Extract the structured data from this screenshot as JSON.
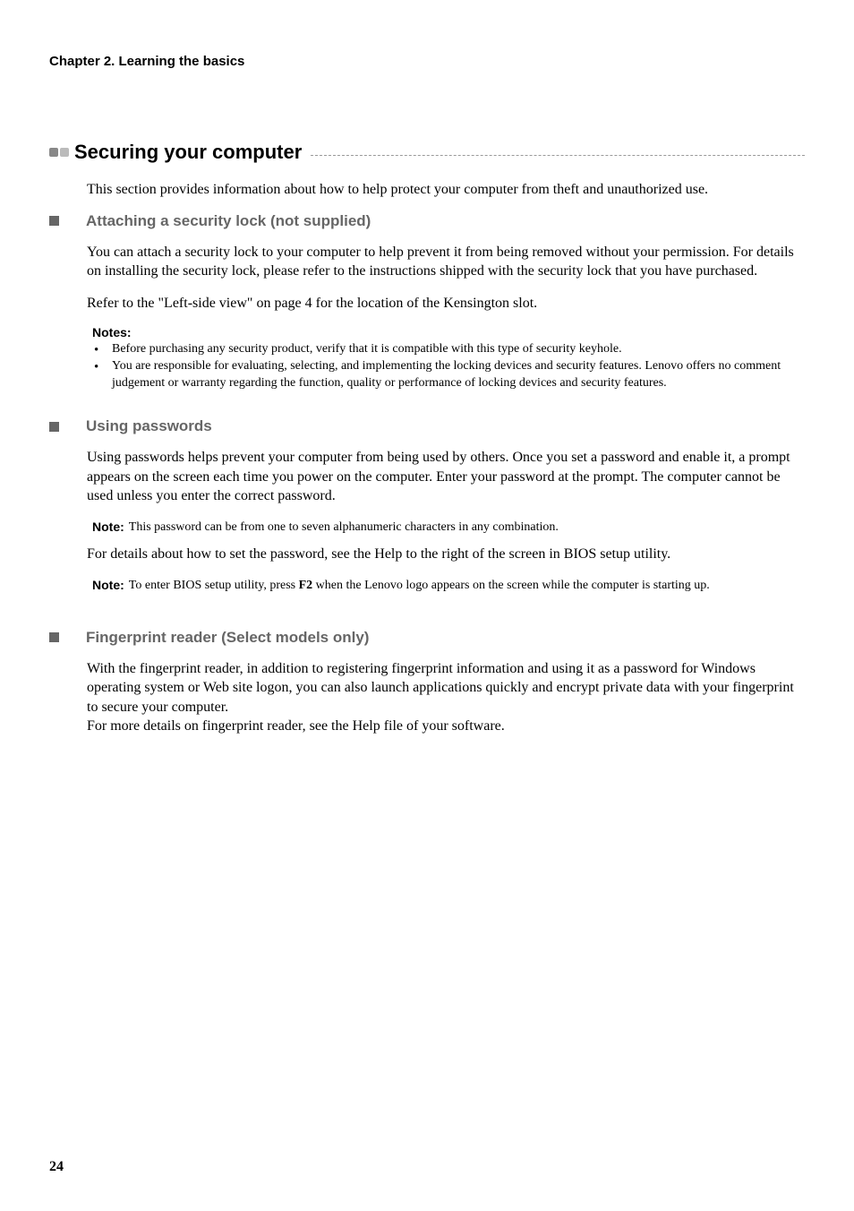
{
  "chapter_header": "Chapter 2. Learning the basics",
  "section": {
    "title": "Securing your computer",
    "intro": "This section provides information about how to help protect your computer from theft and unauthorized use."
  },
  "sub1": {
    "title": "Attaching a security lock (not supplied)",
    "para1": "You can attach a security lock to your computer to help prevent it from being removed without your permission. For details on installing the security lock, please refer to the instructions shipped with the security lock that you have purchased.",
    "para2": "Refer to the \"Left-side view\" on page 4 for the location of the Kensington slot.",
    "notes_label": "Notes:",
    "notes": [
      "Before purchasing any security product, verify that it is compatible with this type of security keyhole.",
      "You are responsible for evaluating, selecting, and implementing the locking devices and security features. Lenovo offers no comment judgement or warranty regarding the function, quality or performance of locking devices and security features."
    ]
  },
  "sub2": {
    "title": "Using passwords",
    "para1": "Using passwords helps prevent your computer from being used by others. Once you set a password and enable it, a prompt appears on the screen each time you power on the computer. Enter your password at the prompt. The computer cannot be used unless you enter the correct password.",
    "note1_label": "Note:",
    "note1_content": "This password can be from one to seven alphanumeric characters in any combination.",
    "para2": "For details about how to set the password, see the Help to the right of the screen in BIOS setup utility.",
    "note2_label": "Note:",
    "note2_content_a": "To enter BIOS setup utility, press ",
    "note2_bold": "F2",
    "note2_content_b": " when the Lenovo logo appears on the screen while the computer is starting up."
  },
  "sub3": {
    "title": "Fingerprint reader (Select models only)",
    "para1": "With the fingerprint reader, in addition to registering fingerprint information and using it as a password for Windows operating system or Web site logon, you can also launch applications quickly and encrypt private data with your fingerprint to secure your computer.",
    "para2": "For more details on fingerprint reader, see the Help file of your software."
  },
  "page_number": "24"
}
